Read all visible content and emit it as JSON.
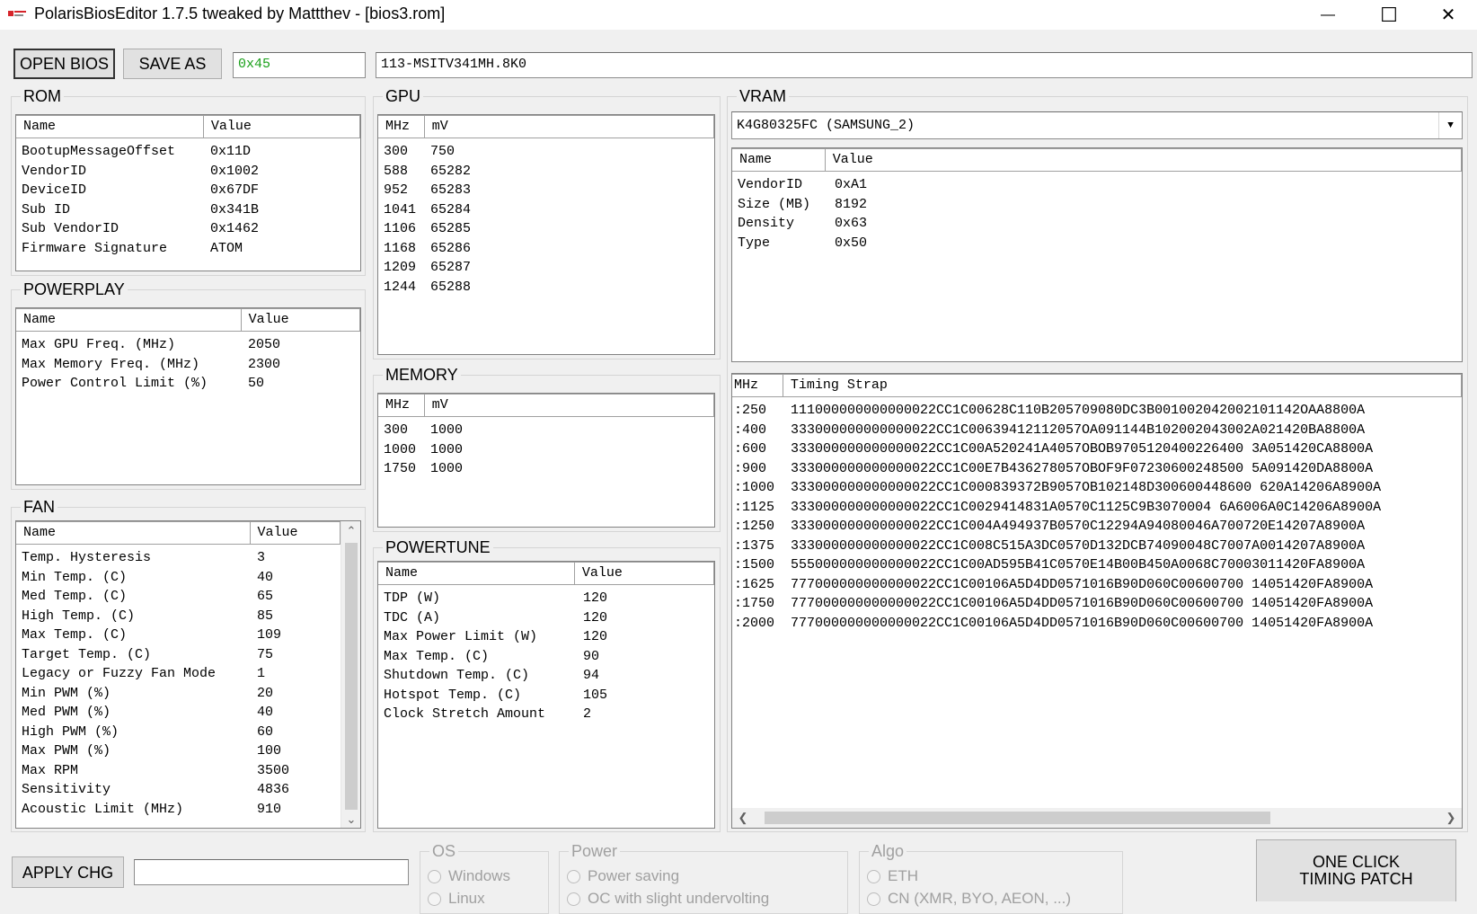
{
  "window": {
    "title": "PolarisBiosEditor 1.7.5 tweaked by Mattthev  - [bios3.rom]",
    "minimize_glyph": "—",
    "maximize_glyph": "☐",
    "close_glyph": "✕"
  },
  "toolbar": {
    "open_label": "OPEN BIOS",
    "save_label": "SAVE AS",
    "checksum_value": "0x45",
    "bios_name_value": "113-MSITV341MH.8K0",
    "checksum_color": "#1aa01a"
  },
  "rom": {
    "title": "ROM",
    "columns": [
      "Name",
      "Value"
    ],
    "rows": [
      [
        "BootupMessageOffset",
        "0x11D"
      ],
      [
        "VendorID",
        "0x1002"
      ],
      [
        "DeviceID",
        "0x67DF"
      ],
      [
        "Sub ID",
        "0x341B"
      ],
      [
        "Sub VendorID",
        "0x1462"
      ],
      [
        "Firmware Signature",
        "ATOM"
      ]
    ]
  },
  "powerplay": {
    "title": "POWERPLAY",
    "columns": [
      "Name",
      "Value"
    ],
    "rows": [
      [
        "Max GPU Freq. (MHz)",
        "2050"
      ],
      [
        "Max Memory Freq. (MHz)",
        "2300"
      ],
      [
        "Power Control Limit (%)",
        "50"
      ]
    ]
  },
  "fan": {
    "title": "FAN",
    "columns": [
      "Name",
      "Value"
    ],
    "rows": [
      [
        "Temp. Hysteresis",
        "3"
      ],
      [
        "Min Temp. (C)",
        "40"
      ],
      [
        "Med Temp. (C)",
        "65"
      ],
      [
        "High Temp. (C)",
        "85"
      ],
      [
        "Max Temp. (C)",
        "109"
      ],
      [
        "Target Temp. (C)",
        "75"
      ],
      [
        "Legacy or Fuzzy Fan Mode",
        "1"
      ],
      [
        "Min PWM (%)",
        "20"
      ],
      [
        "Med PWM (%)",
        "40"
      ],
      [
        "High PWM (%)",
        "60"
      ],
      [
        "Max PWM (%)",
        "100"
      ],
      [
        "Max RPM",
        "3500"
      ],
      [
        "Sensitivity",
        "4836"
      ],
      [
        "Acoustic Limit (MHz)",
        "910"
      ]
    ]
  },
  "gpu": {
    "title": "GPU",
    "columns": [
      "MHz",
      "mV"
    ],
    "rows": [
      [
        "300",
        "750"
      ],
      [
        "588",
        "65282"
      ],
      [
        "952",
        "65283"
      ],
      [
        "1041",
        "65284"
      ],
      [
        "1106",
        "65285"
      ],
      [
        "1168",
        "65286"
      ],
      [
        "1209",
        "65287"
      ],
      [
        "1244",
        "65288"
      ]
    ]
  },
  "memory": {
    "title": "MEMORY",
    "columns": [
      "MHz",
      "mV"
    ],
    "rows": [
      [
        "300",
        "1000"
      ],
      [
        "1000",
        "1000"
      ],
      [
        "1750",
        "1000"
      ]
    ]
  },
  "powertune": {
    "title": "POWERTUNE",
    "columns": [
      "Name",
      "Value"
    ],
    "rows": [
      [
        "TDP (W)",
        "120"
      ],
      [
        "TDC (A)",
        "120"
      ],
      [
        "Max Power Limit (W)",
        "120"
      ],
      [
        "Max Temp. (C)",
        "90"
      ],
      [
        "Shutdown Temp. (C)",
        "94"
      ],
      [
        "Hotspot Temp. (C)",
        "105"
      ],
      [
        "Clock Stretch Amount",
        "2"
      ]
    ]
  },
  "vram": {
    "title": "VRAM",
    "selected": "K4G80325FC (SAMSUNG_2)",
    "columns": [
      "Name",
      "Value"
    ],
    "rows": [
      [
        "VendorID",
        "0xA1"
      ],
      [
        "Size (MB)",
        "8192"
      ],
      [
        "Density",
        "0x63"
      ],
      [
        "Type",
        "0x50"
      ]
    ]
  },
  "timings": {
    "columns": [
      "MHz",
      "Timing Strap"
    ],
    "rows": [
      [
        ":250",
        "111000000000000022CC1C00628C110B205709080DC3B001002042002101142OAA8800A"
      ],
      [
        ":400",
        "333000000000000022CC1C00639412112057OA091144B102002043002A021420BA8800A"
      ],
      [
        ":600",
        "333000000000000022CC1C00A520241A4057OBOB9705120400226400 3A051420CA8800A"
      ],
      [
        ":900",
        "333000000000000022CC1C00E7B436278057OBOF9F07230600248500 5A091420DA8800A"
      ],
      [
        ":1000",
        "333000000000000022CC1C000839372B9057OB102148D300600448600 620A14206A8900A"
      ],
      [
        ":1125",
        "333000000000000022CC1C0029414831A0570C1125C9B3070004 6A6006A0C14206A8900A"
      ],
      [
        ":1250",
        "333000000000000022CC1C004A494937B0570C12294A94080046A700720E14207A8900A"
      ],
      [
        ":1375",
        "333000000000000022CC1C008C515A3DC0570D132DCB74090048C7007A0014207A8900A"
      ],
      [
        ":1500",
        "555000000000000022CC1C00AD595B41C0570E14B00B450A0068C70003011420FA8900A"
      ],
      [
        ":1625",
        "777000000000000022CC1C00106A5D4DD0571016B90D060C00600700 14051420FA8900A"
      ],
      [
        ":1750",
        "777000000000000022CC1C00106A5D4DD0571016B90D060C00600700 14051420FA8900A"
      ],
      [
        ":2000",
        "777000000000000022CC1C00106A5D4DD0571016B90D060C00600700 14051420FA8900A"
      ]
    ]
  },
  "bottom": {
    "apply_label": "APPLY CHG",
    "apply_input_value": "",
    "os_title": "OS",
    "os_options": [
      "Windows",
      "Linux"
    ],
    "power_title": "Power",
    "power_options": [
      "Power saving",
      "OC with slight undervolting"
    ],
    "algo_title": "Algo",
    "algo_options": [
      "ETH",
      "CN (XMR, BYO, AEON, ...)"
    ],
    "patch_label": "ONE CLICK TIMING PATCH"
  },
  "icons": {
    "up": "▲",
    "down": "▼",
    "left": "❮",
    "right": "❯",
    "chevron_up": "⌃",
    "chevron_down": "⌄",
    "dropdown": "▼"
  }
}
